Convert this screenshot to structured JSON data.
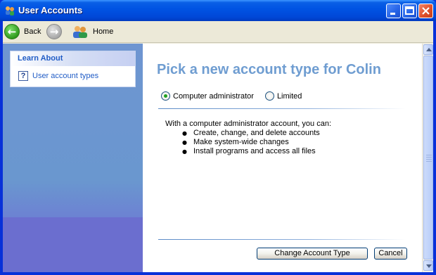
{
  "window": {
    "title": "User Accounts"
  },
  "toolbar": {
    "back_label": "Back",
    "home_label": "Home"
  },
  "sidebar": {
    "learn_about_title": "Learn About",
    "links": [
      {
        "label": "User account types"
      }
    ]
  },
  "main": {
    "title": "Pick a new account type for Colin",
    "options": [
      {
        "label": "Computer administrator",
        "selected": true
      },
      {
        "label": "Limited",
        "selected": false
      }
    ],
    "description": "With a computer administrator account, you can:",
    "bullets": [
      "Create, change, and delete accounts",
      "Make system-wide changes",
      "Install programs and access all files"
    ],
    "buttons": {
      "change": "Change Account Type",
      "cancel": "Cancel"
    }
  },
  "icons": {
    "title": "user-accounts-icon",
    "back": "back-arrow-icon",
    "forward": "forward-arrow-icon",
    "home": "home-users-icon",
    "help": "help-icon"
  },
  "colors": {
    "title_text": "#6f9dd1",
    "link": "#215dc6",
    "accent_green": "#21a121"
  }
}
